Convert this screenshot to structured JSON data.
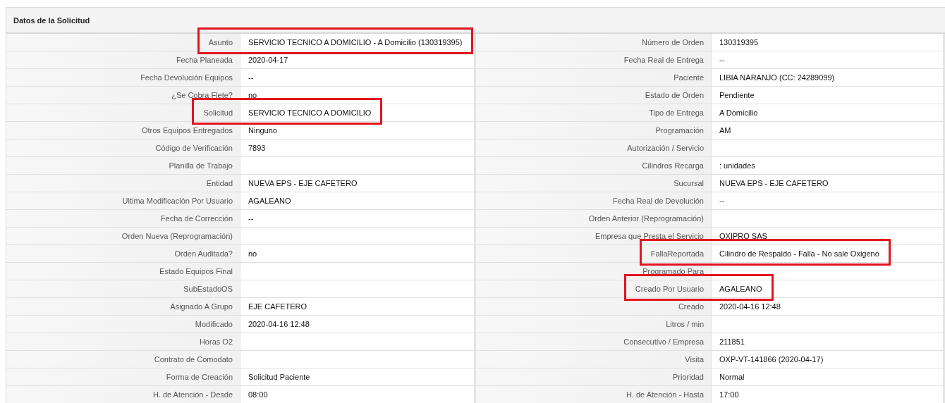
{
  "panel": {
    "title": "Datos de la Solicitud"
  },
  "rows": [
    {
      "left": {
        "label": "Asunto",
        "value": "SERVICIO TECNICO A DOMICILIO - A Domicilio (130319395)",
        "highlighted": true
      },
      "right": {
        "label": "Número de Orden",
        "value": "130319395",
        "highlighted": false
      }
    },
    {
      "left": {
        "label": "Fecha Planeada",
        "value": "2020-04-17",
        "highlighted": false
      },
      "right": {
        "label": "Fecha Real de Entrega",
        "value": "--",
        "highlighted": false
      }
    },
    {
      "left": {
        "label": "Fecha Devolución Equipos",
        "value": "--",
        "highlighted": false
      },
      "right": {
        "label": "Paciente",
        "value": "LIBIA NARANJO (CC: 24289099)",
        "highlighted": false
      }
    },
    {
      "left": {
        "label": "¿Se Cobra Flete?",
        "value": "no",
        "highlighted": false
      },
      "right": {
        "label": "Estado de Orden",
        "value": "Pendiente",
        "highlighted": false
      }
    },
    {
      "left": {
        "label": "Solicitud",
        "value": "SERVICIO TECNICO A DOMICILIO",
        "highlighted": true
      },
      "right": {
        "label": "Tipo de Entrega",
        "value": "A Domicilio",
        "highlighted": false
      }
    },
    {
      "left": {
        "label": "Otros Equipos Entregados",
        "value": "Ninguno",
        "highlighted": false
      },
      "right": {
        "label": "Programación",
        "value": "AM",
        "highlighted": false
      }
    },
    {
      "left": {
        "label": "Código de Verificación",
        "value": "7893",
        "highlighted": false
      },
      "right": {
        "label": "Autorización / Servicio",
        "highlighted": false
      }
    },
    {
      "left": {
        "label": "Planilla de Trabajo",
        "highlighted": false
      },
      "right": {
        "label": "Cilindros Recarga",
        "value": ": unidades",
        "highlighted": false
      }
    },
    {
      "left": {
        "label": "Entidad",
        "value": "NUEVA EPS - EJE CAFETERO",
        "highlighted": false
      },
      "right": {
        "label": "Sucursal",
        "value": "NUEVA EPS - EJE CAFETERO",
        "highlighted": false
      }
    },
    {
      "left": {
        "label": "Ultima Modificación Por Usuario",
        "value": "AGALEANO",
        "highlighted": false
      },
      "right": {
        "label": "Fecha Real de Devolución",
        "value": "--",
        "highlighted": false
      }
    },
    {
      "left": {
        "label": "Fecha de Corrección",
        "value": "--",
        "highlighted": false
      },
      "right": {
        "label": "Orden Anterior (Reprogramación)",
        "highlighted": false
      }
    },
    {
      "left": {
        "label": "Orden Nueva (Reprogramación)",
        "highlighted": false
      },
      "right": {
        "label": "Empresa que Presta el Servicio",
        "value": "OXIPRO SAS",
        "highlighted": false
      }
    },
    {
      "left": {
        "label": "Orden Auditada?",
        "value": "no",
        "highlighted": false
      },
      "right": {
        "label": "FallaReportada",
        "value": "Cilindro de Respaldo - Falla - No sale Oxigeno",
        "highlighted": true
      }
    },
    {
      "left": {
        "label": "Estado Equipos Final",
        "highlighted": false
      },
      "right": {
        "label": "Programado Para",
        "highlighted": false
      }
    },
    {
      "left": {
        "label": "SubEstadoOS",
        "highlighted": false
      },
      "right": {
        "label": "Creado Por Usuario",
        "value": "AGALEANO",
        "highlighted": true
      }
    },
    {
      "left": {
        "label": "Asignado A Grupo",
        "value": "EJE CAFETERO",
        "highlighted": false
      },
      "right": {
        "label": "Creado",
        "value": "2020-04-16 12:48",
        "highlighted": false
      }
    },
    {
      "left": {
        "label": "Modificado",
        "value": "2020-04-16 12:48",
        "highlighted": false
      },
      "right": {
        "label": "Litros / min",
        "highlighted": false
      }
    },
    {
      "left": {
        "label": "Horas O2",
        "highlighted": false
      },
      "right": {
        "label": "Consecutivo / Empresa",
        "value": "211851",
        "highlighted": false
      }
    },
    {
      "left": {
        "label": "Contrato de Comodato",
        "highlighted": false
      },
      "right": {
        "label": "Visita",
        "value": "OXP-VT-141866 (2020-04-17)",
        "highlighted": false
      }
    },
    {
      "left": {
        "label": "Forma de Creación",
        "value": "Solicitud Paciente",
        "highlighted": false
      },
      "right": {
        "label": "Prioridad",
        "value": "Normal",
        "highlighted": false
      }
    },
    {
      "left": {
        "label": "H. de Atención - Desde",
        "value": "08:00",
        "highlighted": false
      },
      "right": {
        "label": "H. de Atención - Hasta",
        "value": "17:00",
        "highlighted": false
      }
    }
  ]
}
